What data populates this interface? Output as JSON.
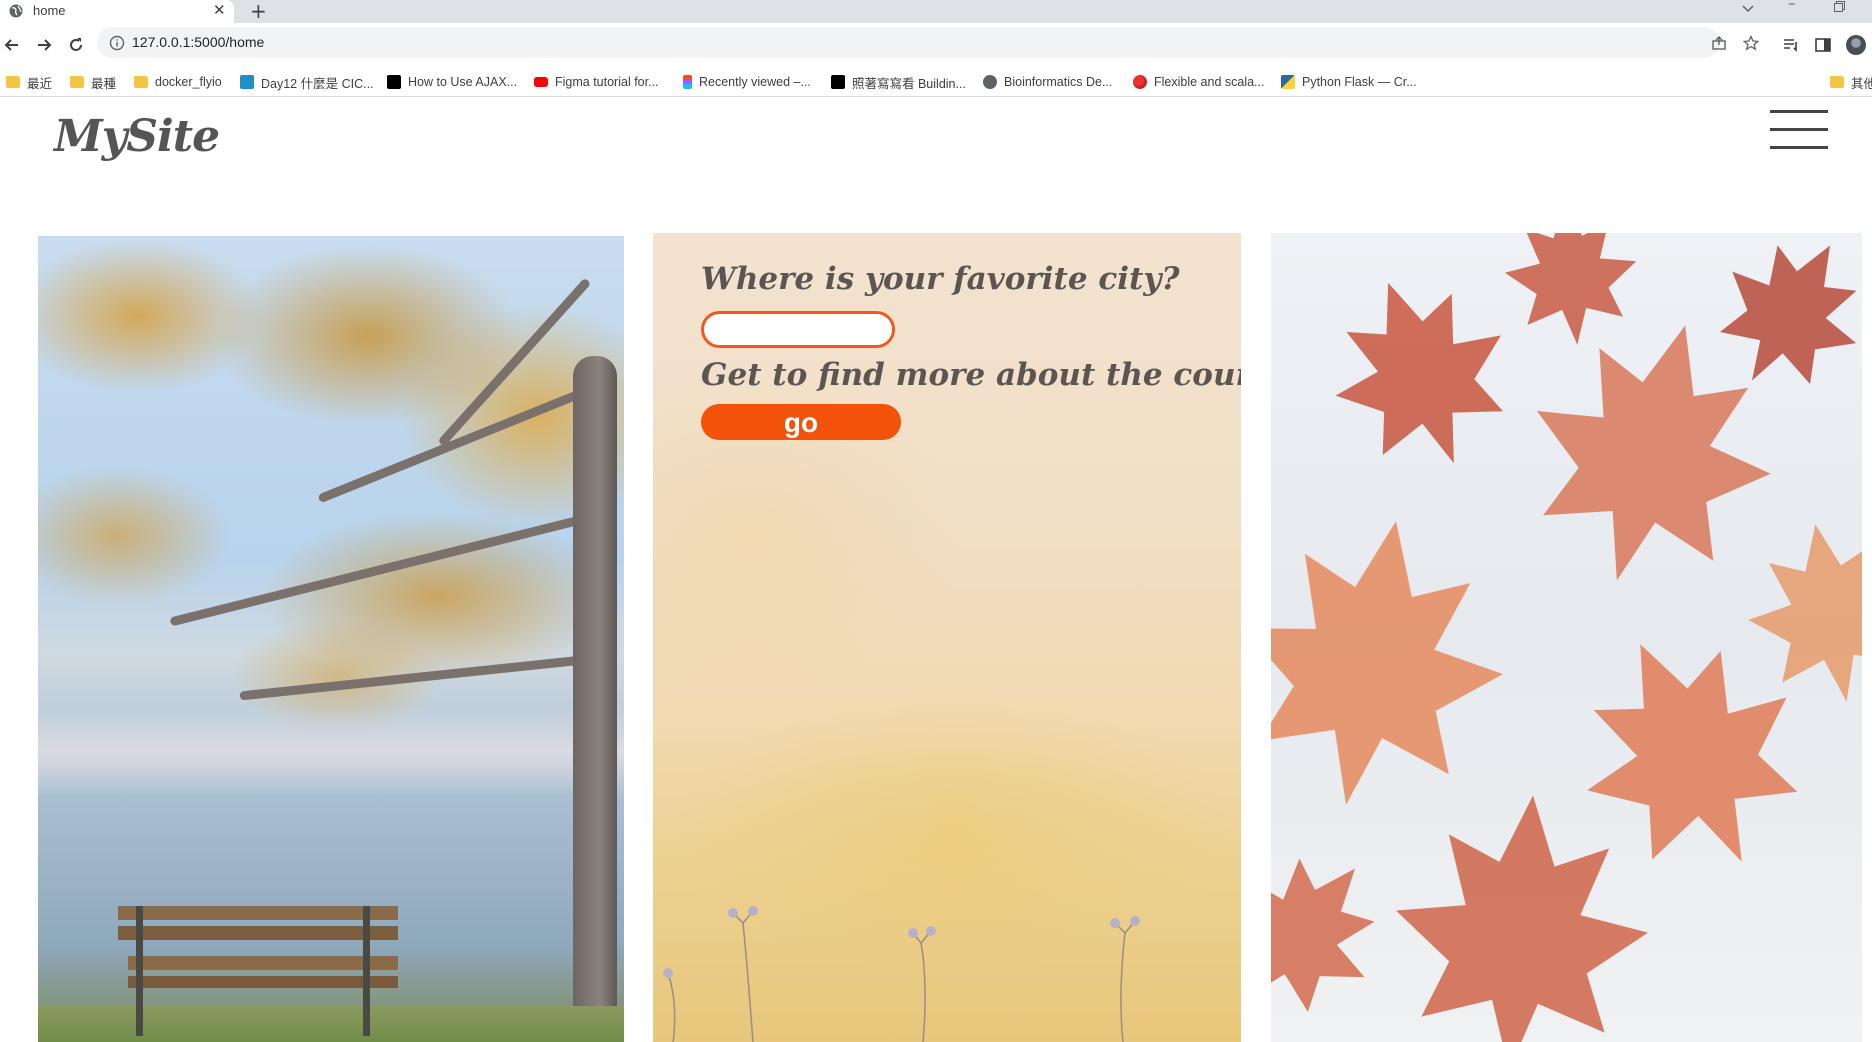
{
  "browser": {
    "tab": {
      "title": "home",
      "favicon": "globe-icon",
      "close": "✕"
    },
    "new_tab": "+",
    "address": {
      "url": "127.0.0.1:5000/home"
    },
    "bookmarks": [
      {
        "label": "最近",
        "icon": "folder-icon"
      },
      {
        "label": "最種",
        "icon": "folder-icon"
      },
      {
        "label": "docker_flyio",
        "icon": "folder-icon"
      },
      {
        "label": "Day12 什麼是 CIC...",
        "icon": "ithome-icon"
      },
      {
        "label": "How to Use AJAX...",
        "icon": "medium-icon"
      },
      {
        "label": "Figma tutorial for...",
        "icon": "youtube-icon"
      },
      {
        "label": "Recently viewed –...",
        "icon": "figma-icon"
      },
      {
        "label": "照著寫寫看 Buildin...",
        "icon": "medium-icon"
      },
      {
        "label": "Bioinformatics De...",
        "icon": "globe-icon"
      },
      {
        "label": "Flexible and scala...",
        "icon": "balloon-icon"
      },
      {
        "label": "Python Flask — Cr...",
        "icon": "pypi-icon"
      },
      {
        "label": "其他",
        "icon": "folder-icon"
      }
    ],
    "colors": {
      "tabstrip": "#dee1e6",
      "omnibox": "#f1f3f4"
    }
  },
  "site": {
    "logo": "MySite",
    "menu_icon": "hamburger-menu-icon",
    "form": {
      "question": "Where is your favorite city?",
      "input_value": "",
      "subline": "Get to find more about the country.",
      "button_label": "go"
    },
    "images": [
      "autumn-tree-lake-bench-photo",
      "floral-wall-texture-photo",
      "maple-leaves-photo"
    ],
    "colors": {
      "accent": "#f3520b",
      "input_border": "#ef5a1c",
      "heading": "#5b5652"
    }
  }
}
